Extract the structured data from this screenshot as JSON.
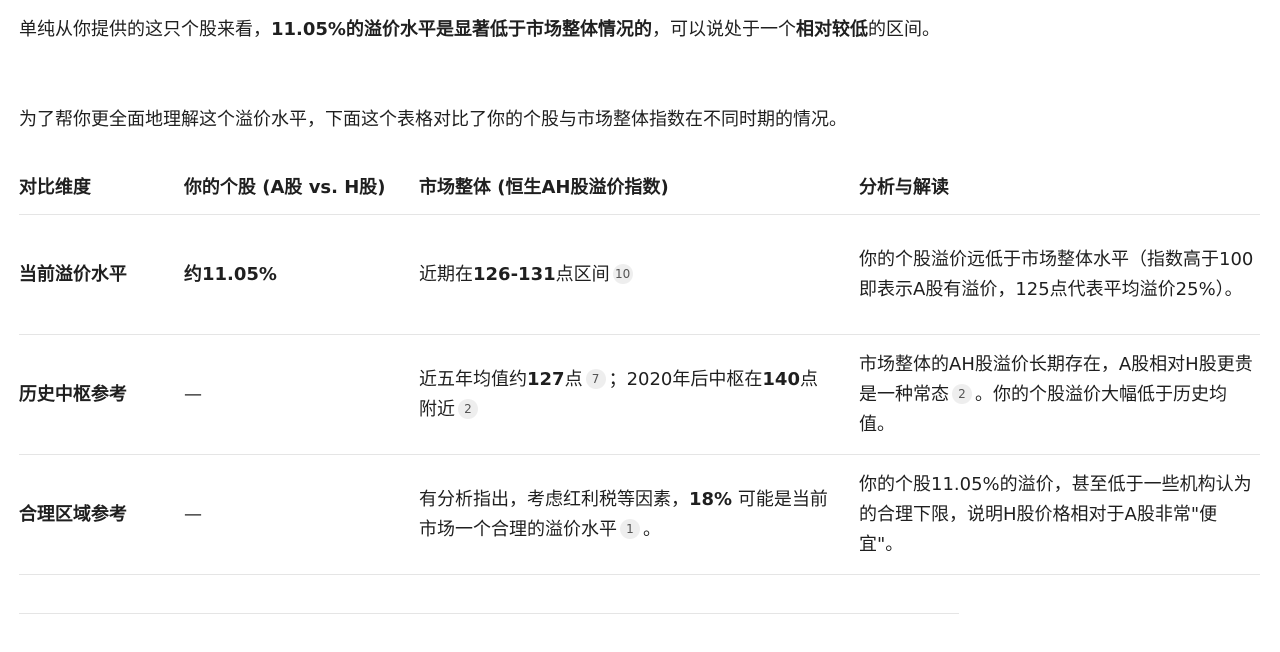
{
  "intro": {
    "p1_a": "单纯从你提供的这只个股来看，",
    "p1_b": "11.05%的溢价水平是显著低于市场整体情况的",
    "p1_c": "，可以说处于一个",
    "p1_d": "相对较低",
    "p1_e": "的区间。",
    "p2": "为了帮你更全面地理解这个溢价水平，下面这个表格对比了你的个股与市场整体指数在不同时期的情况。"
  },
  "table": {
    "headers": [
      "对比维度",
      "你的个股 (A股 vs. H股)",
      "市场整体 (恒生AH股溢价指数)",
      "分析与解读"
    ],
    "rows": [
      {
        "dimension": "当前溢价水平",
        "stock": "约11.05%",
        "market": {
          "a": "近期在",
          "b": "126-131",
          "c": "点区间",
          "cite1": "10"
        },
        "analysis": {
          "a": "你的个股溢价远低于市场整体水平（指数高于100即表示A股有溢价，125点代表平均溢价25%）。"
        }
      },
      {
        "dimension": "历史中枢参考",
        "stock": "—",
        "market": {
          "a": "近五年均值约",
          "b": "127",
          "c": "点",
          "cite1": "7",
          "d": "；2020年后中枢在",
          "e": "140",
          "f": "点附近",
          "cite2": "2"
        },
        "analysis": {
          "a": "市场整体的AH股溢价长期存在，A股相对H股更贵是一种常态",
          "cite1": "2",
          "b": "。你的个股溢价大幅低于历史均值。"
        }
      },
      {
        "dimension": "合理区域参考",
        "stock": "—",
        "market": {
          "a": "有分析指出，考虑红利税等因素，",
          "b": "18%",
          "c": " 可能是当前市场一个合理的溢价水平",
          "cite1": "1",
          "d": "。"
        },
        "analysis": {
          "a": "你的个股11.05%的溢价，甚至低于一些机构认为的合理下限，说明H股价格相对于A股非常\"便宜\"。"
        }
      }
    ]
  }
}
